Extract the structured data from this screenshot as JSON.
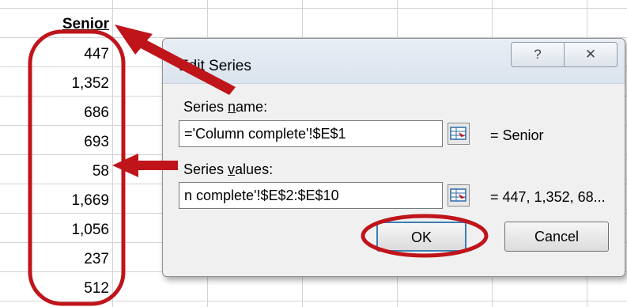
{
  "sheet": {
    "header": "Senior",
    "values": [
      "447",
      "1,352",
      "686",
      "693",
      "58",
      "1,669",
      "1,056",
      "237",
      "512"
    ]
  },
  "dialog": {
    "title": "Edit Series",
    "help_glyph": "?",
    "close_glyph": "✕",
    "series_name_label_pre": "Series ",
    "series_name_label_u": "n",
    "series_name_label_post": "ame:",
    "series_name_value": "='Column complete'!$E$1",
    "series_name_preview": "= Senior",
    "series_values_label_pre": "Series ",
    "series_values_label_u": "v",
    "series_values_label_post": "alues:",
    "series_values_value": "n complete'!$E$2:$E$10",
    "series_values_preview": "= 447, 1,352, 68...",
    "ok_label": "OK",
    "cancel_label": "Cancel"
  },
  "annotation_color": "#c0141b"
}
